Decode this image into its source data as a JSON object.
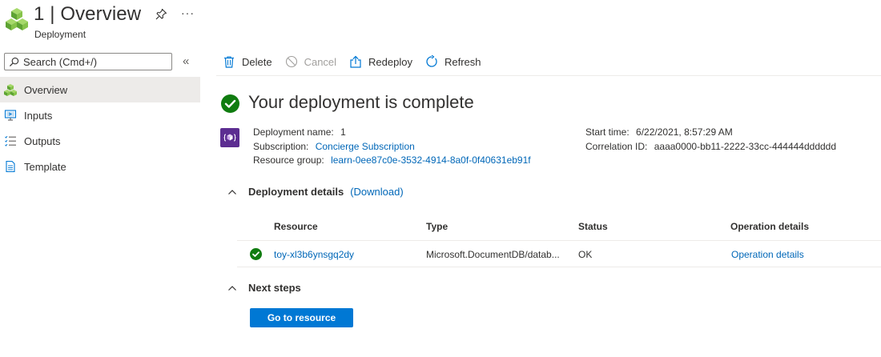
{
  "header": {
    "title": "1 | Overview",
    "subtitle": "Deployment",
    "more": "···"
  },
  "search": {
    "placeholder": "Search (Cmd+/)",
    "collapse": "«"
  },
  "sidebar": {
    "items": [
      {
        "label": "Overview",
        "icon": "deployment-cubes-icon",
        "active": true
      },
      {
        "label": "Inputs",
        "icon": "inputs-icon"
      },
      {
        "label": "Outputs",
        "icon": "outputs-list-icon"
      },
      {
        "label": "Template",
        "icon": "template-document-icon"
      }
    ]
  },
  "toolbar": {
    "delete": "Delete",
    "cancel": "Cancel",
    "redeploy": "Redeploy",
    "refresh": "Refresh"
  },
  "status": {
    "title": "Your deployment is complete",
    "color": "#107c10"
  },
  "summary": {
    "deployment_name_label": "Deployment name:",
    "deployment_name": "1",
    "subscription_label": "Subscription:",
    "subscription": "Concierge Subscription",
    "resource_group_label": "Resource group:",
    "resource_group": "learn-0ee87c0e-3532-4914-8a0f-0f40631eb91f",
    "start_time_label": "Start time:",
    "start_time": "6/22/2021, 8:57:29 AM",
    "correlation_id_label": "Correlation ID:",
    "correlation_id": "aaaa0000-bb11-2222-33cc-444444dddddd"
  },
  "details": {
    "heading": "Deployment details",
    "download": "(Download)",
    "columns": [
      "Resource",
      "Type",
      "Status",
      "Operation details"
    ],
    "rows": [
      {
        "resource": "toy-xl3b6ynsgq2dy",
        "type": "Microsoft.DocumentDB/datab...",
        "status": "OK",
        "operation": "Operation details"
      }
    ]
  },
  "next_steps": {
    "heading": "Next steps",
    "button": "Go to resource"
  },
  "colors": {
    "accent": "#0078d4",
    "link": "#0067b8",
    "success": "#107c10",
    "cosmos": "#5c2d91"
  }
}
